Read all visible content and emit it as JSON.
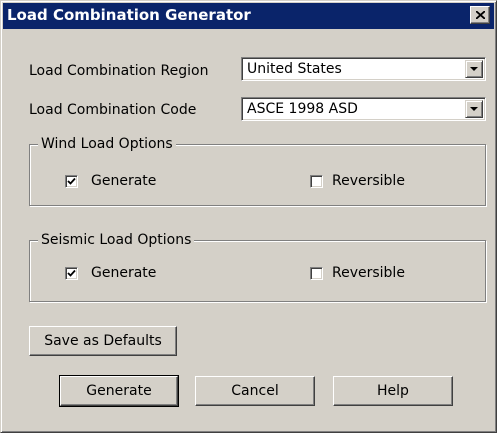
{
  "window": {
    "title": "Load Combination Generator"
  },
  "region": {
    "label": "Load Combination Region",
    "value": "United States"
  },
  "code": {
    "label": "Load Combination Code",
    "value": "ASCE 1998 ASD"
  },
  "wind": {
    "legend": "Wind Load Options",
    "generate_label": "Generate",
    "generate_checked": true,
    "reversible_label": "Reversible",
    "reversible_checked": false
  },
  "seismic": {
    "legend": "Seismic Load Options",
    "generate_label": "Generate",
    "generate_checked": true,
    "reversible_label": "Reversible",
    "reversible_checked": false
  },
  "buttons": {
    "save_defaults": "Save as Defaults",
    "generate": "Generate",
    "cancel": "Cancel",
    "help": "Help"
  },
  "icons": {
    "close": "close-icon",
    "dropdown": "chevron-down-icon",
    "check": "checkmark-icon"
  },
  "colors": {
    "titlebar": "#0a246a",
    "face": "#d4d0c8"
  }
}
